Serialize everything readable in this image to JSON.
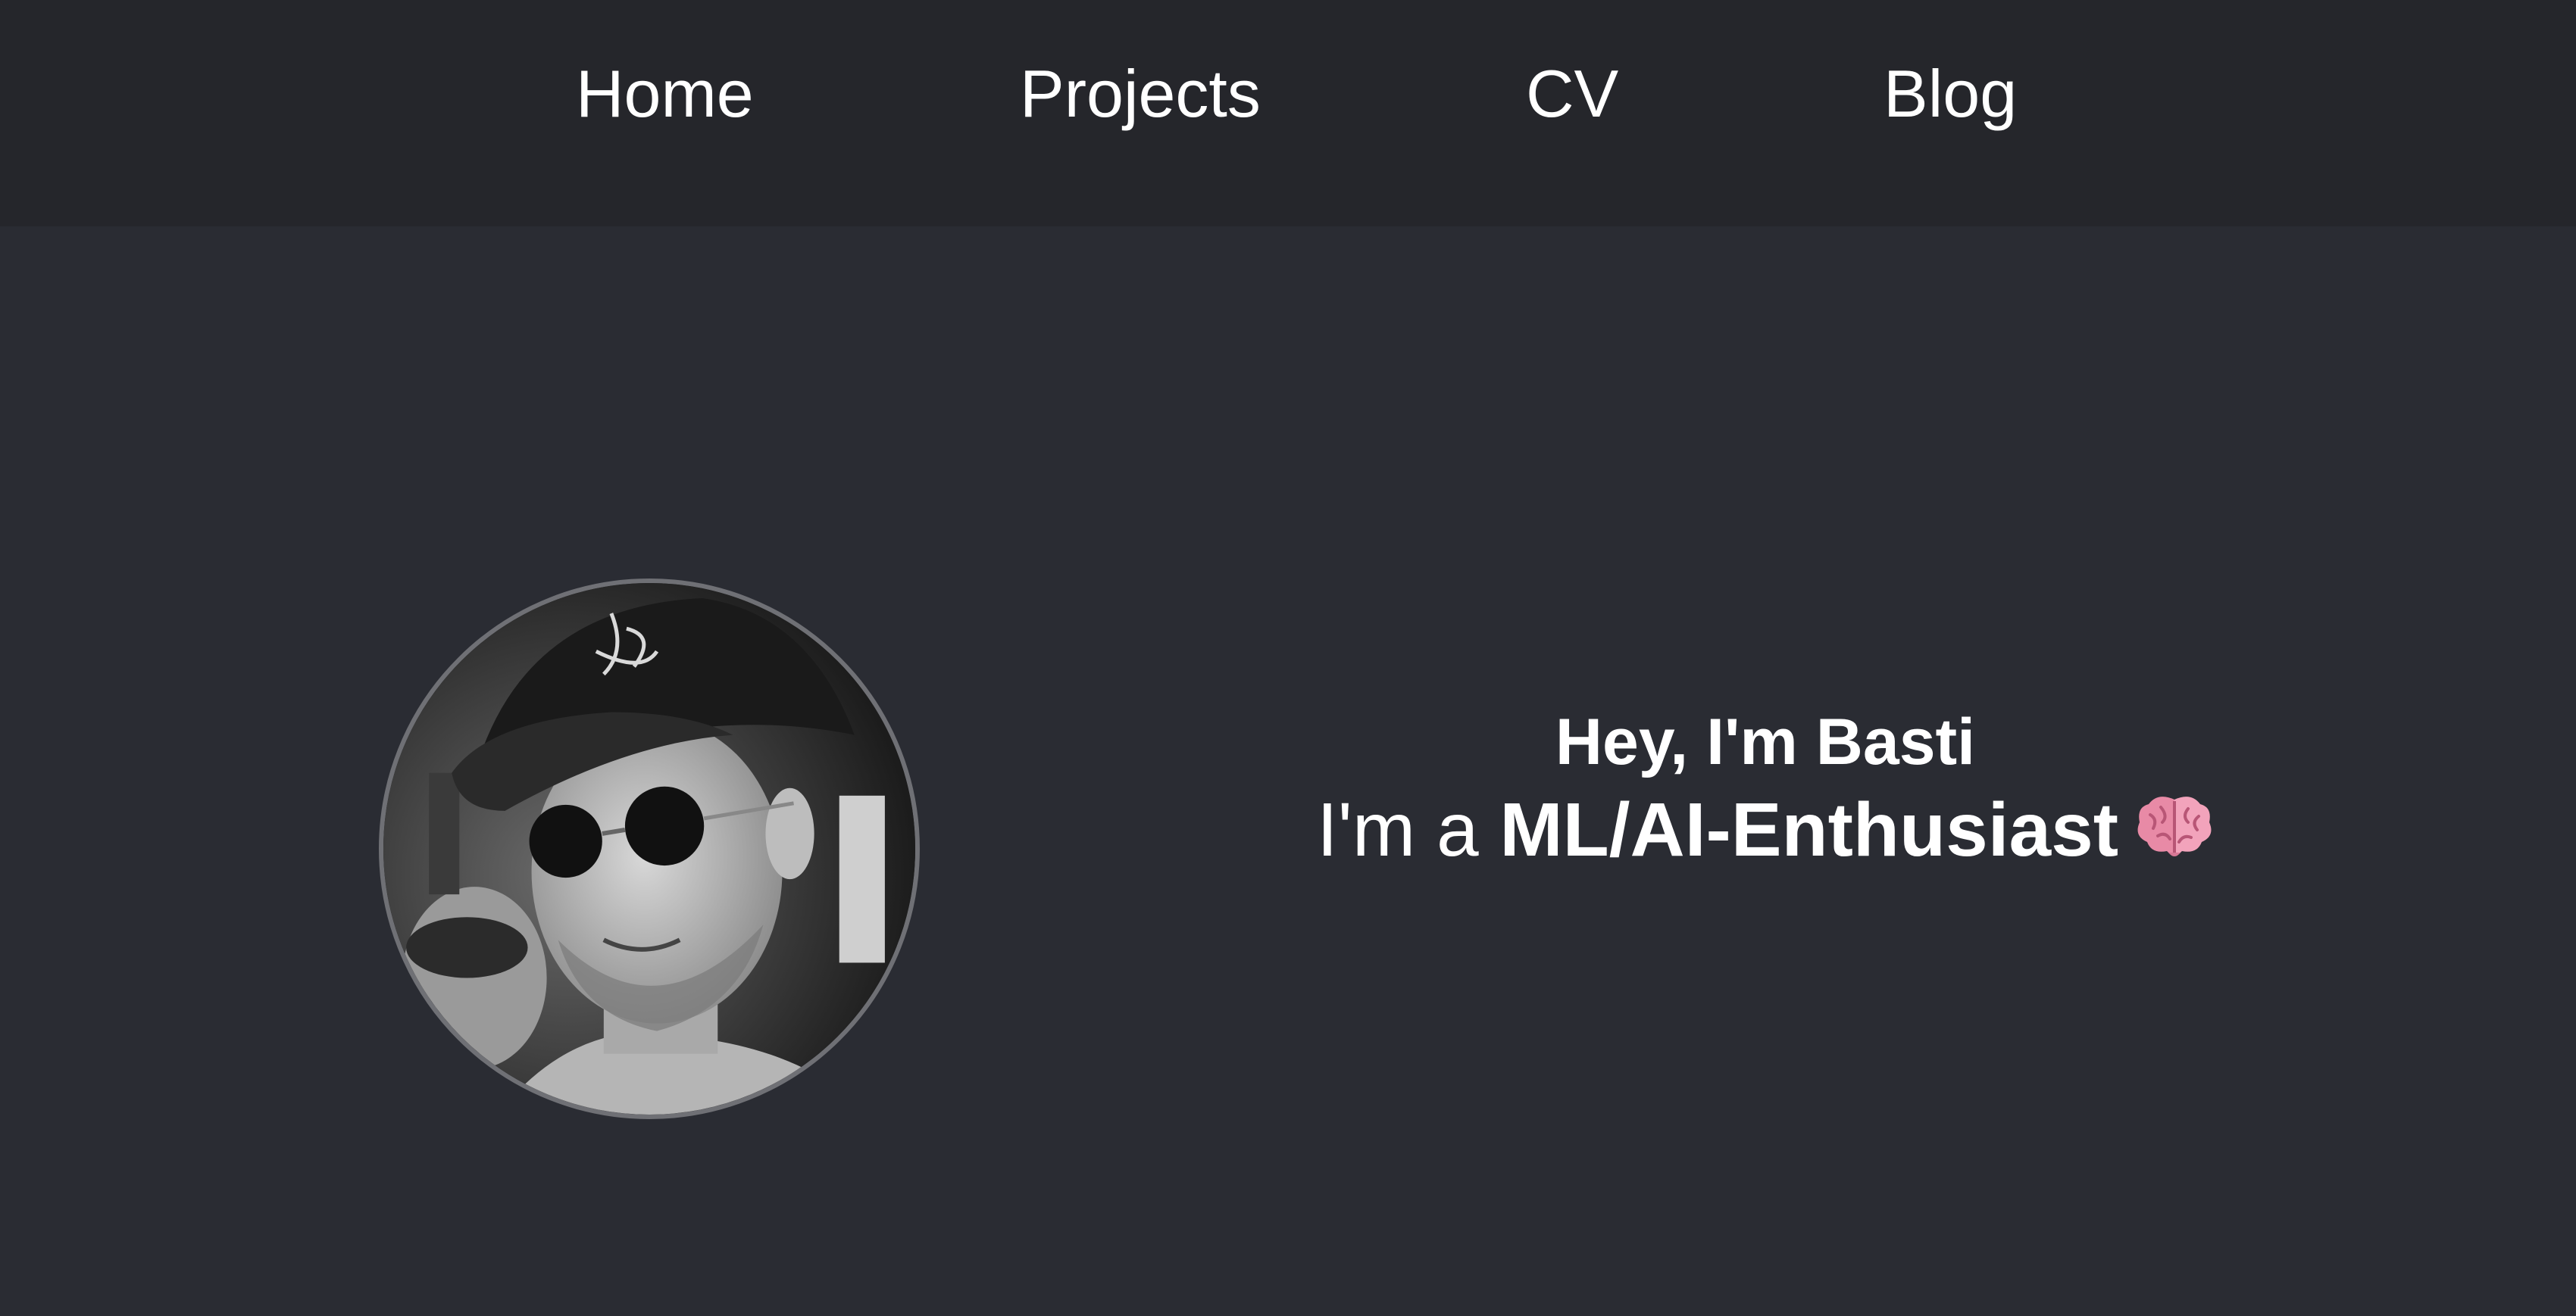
{
  "nav": {
    "items": [
      {
        "label": "Home"
      },
      {
        "label": "Projects"
      },
      {
        "label": "CV"
      },
      {
        "label": "Blog"
      }
    ]
  },
  "profile": {
    "avatar_icon": "profile-photo",
    "greeting": "Hey, I'm Basti",
    "role_prefix": "I'm a",
    "role_title": "ML/AI-Enthusiast",
    "role_emoji_icon": "brain-icon"
  },
  "colors": {
    "background": "#2a2c33",
    "navbar_background": "#25262b",
    "text": "#ffffff",
    "avatar_border": "#6f7075",
    "brain": "#e88aa6"
  }
}
